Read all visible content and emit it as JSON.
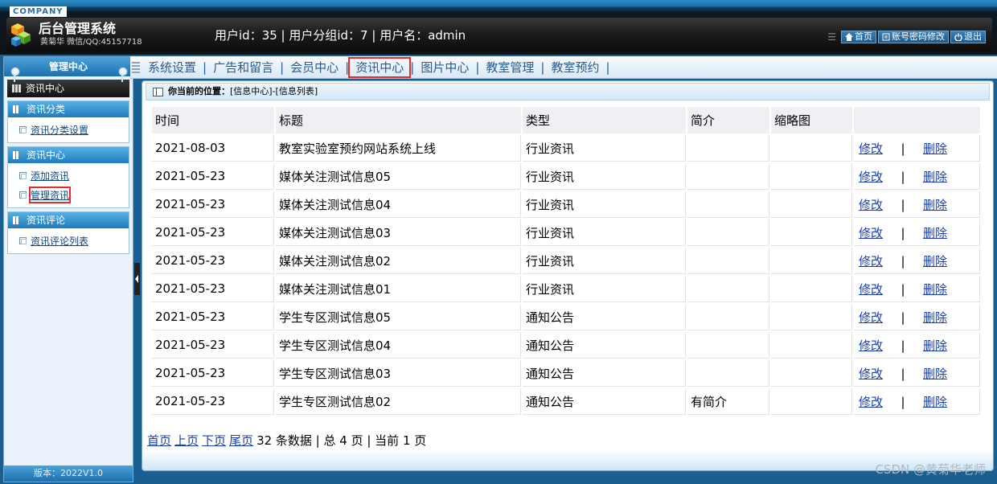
{
  "header": {
    "company": "COMPANY",
    "title": "后台管理系统",
    "subtitle": "黄菊华 微信/QQ:45157718",
    "user_info": "用户id：35 | 用户分组id：7 | 用户名：admin",
    "buttons": [
      {
        "label": "首页",
        "icon": "home-icon"
      },
      {
        "label": "账号密码修改",
        "icon": "edit-icon"
      },
      {
        "label": "退出",
        "icon": "power-icon"
      }
    ]
  },
  "sidebar": {
    "top_label": "管理中心",
    "current": "资讯中心",
    "groups": [
      {
        "title": "资讯分类",
        "items": [
          "资讯分类设置"
        ]
      },
      {
        "title": "资讯中心",
        "items": [
          "添加资讯",
          "管理资讯"
        ]
      },
      {
        "title": "资讯评论",
        "items": [
          "资讯评论列表"
        ]
      }
    ],
    "version": "版本：2022V1.0"
  },
  "nav": {
    "items": [
      "系统设置",
      "广告和留言",
      "会员中心",
      "资讯中心",
      "图片中心",
      "教室管理",
      "教室预约"
    ],
    "active": "资讯中心"
  },
  "breadcrumb": {
    "label": "你当前的位置：",
    "path": "[信息中心]-[信息列表]"
  },
  "table": {
    "columns": [
      "时间",
      "标题",
      "类型",
      "简介",
      "缩略图",
      ""
    ],
    "edit_label": "修改",
    "delete_label": "删除",
    "separator": "|",
    "rows": [
      {
        "time": "2021-08-03",
        "title": "教室实验室预约网站系统上线",
        "type": "行业资讯",
        "intro": "",
        "thumb": ""
      },
      {
        "time": "2021-05-23",
        "title": "媒体关注测试信息05",
        "type": "行业资讯",
        "intro": "",
        "thumb": ""
      },
      {
        "time": "2021-05-23",
        "title": "媒体关注测试信息04",
        "type": "行业资讯",
        "intro": "",
        "thumb": ""
      },
      {
        "time": "2021-05-23",
        "title": "媒体关注测试信息03",
        "type": "行业资讯",
        "intro": "",
        "thumb": ""
      },
      {
        "time": "2021-05-23",
        "title": "媒体关注测试信息02",
        "type": "行业资讯",
        "intro": "",
        "thumb": ""
      },
      {
        "time": "2021-05-23",
        "title": "媒体关注测试信息01",
        "type": "行业资讯",
        "intro": "",
        "thumb": ""
      },
      {
        "time": "2021-05-23",
        "title": "学生专区测试信息05",
        "type": "通知公告",
        "intro": "",
        "thumb": ""
      },
      {
        "time": "2021-05-23",
        "title": "学生专区测试信息04",
        "type": "通知公告",
        "intro": "",
        "thumb": ""
      },
      {
        "time": "2021-05-23",
        "title": "学生专区测试信息03",
        "type": "通知公告",
        "intro": "",
        "thumb": ""
      },
      {
        "time": "2021-05-23",
        "title": "学生专区测试信息02",
        "type": "通知公告",
        "intro": "有简介",
        "thumb": ""
      }
    ]
  },
  "pager": {
    "first": "首页",
    "prev": "上页",
    "next": "下页",
    "last": "尾页",
    "summary": "32 条数据 | 总 4 页 | 当前 1 页"
  },
  "watermark": "CSDN @黄菊华老师"
}
